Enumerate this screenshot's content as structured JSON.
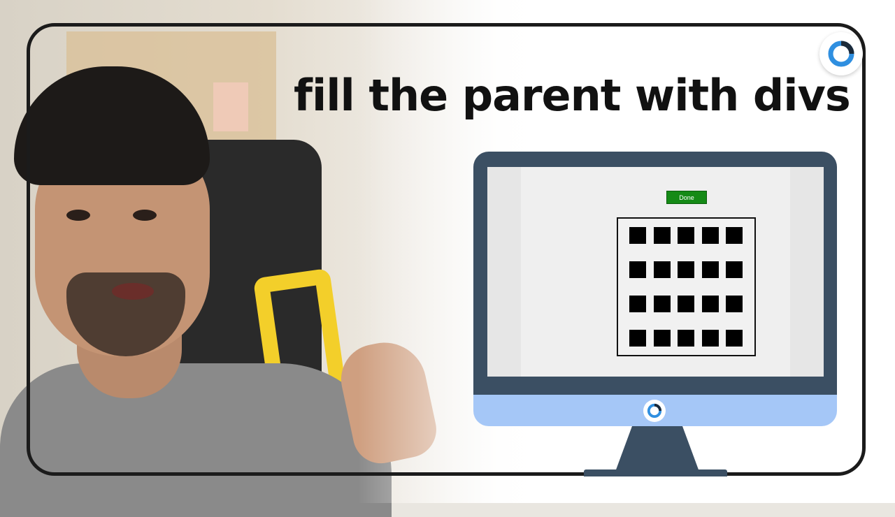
{
  "title": "fill the parent with divs",
  "screen": {
    "button_label": "Done",
    "grid": {
      "rows": 4,
      "cols": 5
    }
  },
  "colors": {
    "monitor_frame": "#3b4f63",
    "monitor_chin": "#a5c7f7",
    "button_bg": "#158a16",
    "cell": "#000000",
    "logo_blue": "#2f8fe0"
  },
  "icons": {
    "corner_logo": "brand-logo-icon",
    "chin_logo": "brand-logo-icon"
  }
}
